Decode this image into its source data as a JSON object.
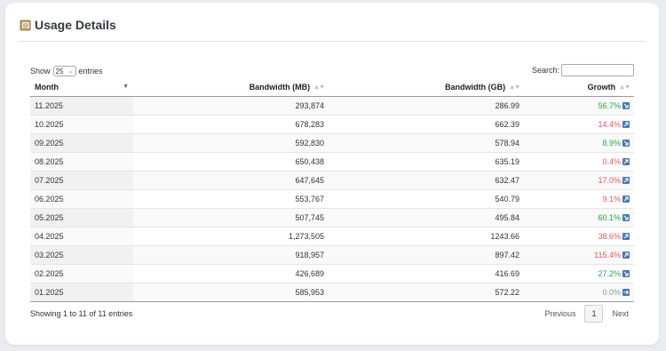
{
  "header": {
    "title": "Usage Details",
    "icon": "ledger-icon"
  },
  "controls": {
    "show_label": "Show",
    "entries_value": "25",
    "entries_label": "entries",
    "search_label": "Search:",
    "search_value": ""
  },
  "table": {
    "columns": [
      "Month",
      "Bandwidth (MB)",
      "Bandwidth (GB)",
      "Growth"
    ],
    "rows": [
      {
        "month": "11.2025",
        "mb": "293,874",
        "gb": "286.99",
        "growth": "56.7%",
        "trend": "pos"
      },
      {
        "month": "10.2025",
        "mb": "678,283",
        "gb": "662.39",
        "growth": "14.4%",
        "trend": "neg"
      },
      {
        "month": "09.2025",
        "mb": "592,830",
        "gb": "578.94",
        "growth": "8.9%",
        "trend": "pos"
      },
      {
        "month": "08.2025",
        "mb": "650,438",
        "gb": "635.19",
        "growth": "0.4%",
        "trend": "neg"
      },
      {
        "month": "07.2025",
        "mb": "647,645",
        "gb": "632.47",
        "growth": "17.0%",
        "trend": "neg"
      },
      {
        "month": "06.2025",
        "mb": "553,767",
        "gb": "540.79",
        "growth": "9.1%",
        "trend": "neg"
      },
      {
        "month": "05.2025",
        "mb": "507,745",
        "gb": "495.84",
        "growth": "60.1%",
        "trend": "pos"
      },
      {
        "month": "04.2025",
        "mb": "1,273,505",
        "gb": "1243.66",
        "growth": "38.6%",
        "trend": "neg"
      },
      {
        "month": "03.2025",
        "mb": "918,957",
        "gb": "897.42",
        "growth": "115.4%",
        "trend": "neg"
      },
      {
        "month": "02.2025",
        "mb": "426,689",
        "gb": "416.69",
        "growth": "27.2%",
        "trend": "pos"
      },
      {
        "month": "01.2025",
        "mb": "585,953",
        "gb": "572.22",
        "growth": "0.0%",
        "trend": "zero"
      }
    ]
  },
  "footer": {
    "info": "Showing 1 to 11 of 11 entries",
    "previous": "Previous",
    "current_page": "1",
    "next": "Next"
  },
  "colors": {
    "positive": "#28a745",
    "negative": "#e05a5a",
    "neutral": "#8a94a1",
    "trend_icon": "#4a7bb0"
  }
}
